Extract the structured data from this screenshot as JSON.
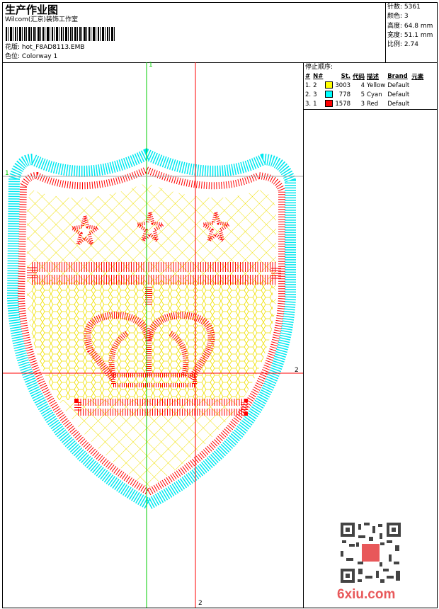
{
  "header": {
    "title": "生产作业图",
    "company": "Wilcom(汇京)装饰工作室",
    "design_label": "花版:",
    "design_value": "hot_F8AD8113.EMB",
    "colorway_label": "色位:",
    "colorway_value": "Colorway 1"
  },
  "stats": [
    {
      "label": "针数:",
      "value": "5361"
    },
    {
      "label": "颜色:",
      "value": "3"
    },
    {
      "label": "高度:",
      "value": "64.8 mm"
    },
    {
      "label": "宽度:",
      "value": "51.1 mm"
    },
    {
      "label": "比例:",
      "value": "2.74"
    }
  ],
  "stop_sequence": {
    "title": "停止顺序:",
    "columns": [
      "#",
      "N#",
      "St.",
      "代码",
      "描述",
      "Brand",
      "元素"
    ],
    "rows": [
      {
        "idx": "1.",
        "n": "2",
        "color": "#ffff00",
        "st": "3003",
        "code": "4",
        "desc": "Yellow",
        "brand": "Default"
      },
      {
        "idx": "2.",
        "n": "3",
        "color": "#00ffff",
        "st": "778",
        "code": "5",
        "desc": "Cyan",
        "brand": "Default"
      },
      {
        "idx": "3.",
        "n": "1",
        "color": "#ff0000",
        "st": "1578",
        "code": "3",
        "desc": "Red",
        "brand": "Default"
      }
    ]
  },
  "guides": {
    "green_label": "1",
    "red_label": "2",
    "green_color": "#00cc00",
    "red_color": "#ff0000"
  },
  "watermark": "6xiu.com"
}
